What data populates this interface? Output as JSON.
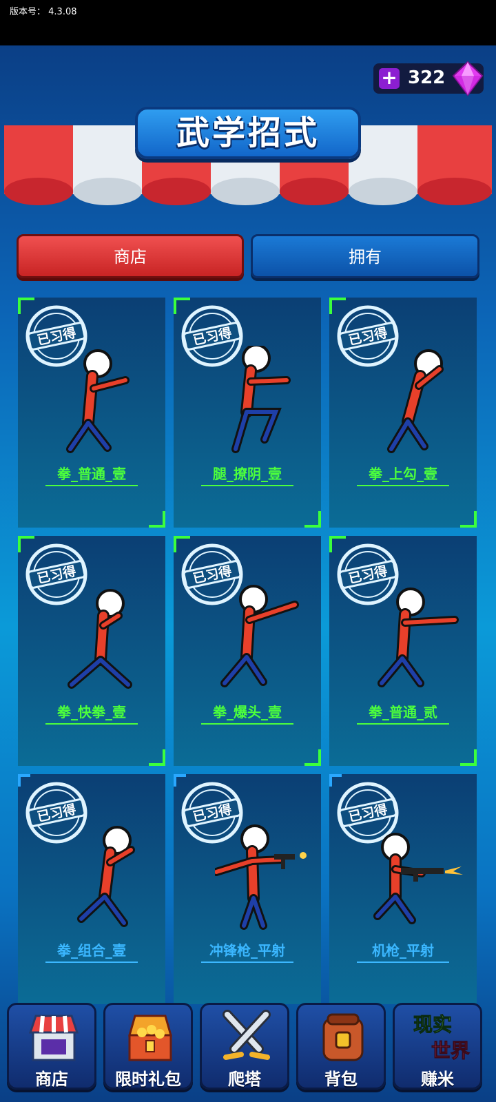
{
  "status": {
    "version_label": "版本号：",
    "version": "4.3.08"
  },
  "currency": {
    "gems": "322"
  },
  "title": "武学招式",
  "tabs": [
    {
      "label": "商店",
      "active": true
    },
    {
      "label": "拥有",
      "active": false
    }
  ],
  "stamp_text": "已习得",
  "moves": [
    {
      "name": "拳_普通_壹",
      "style": "green",
      "pose": "punch"
    },
    {
      "name": "腿_撩阴_壹",
      "style": "green",
      "pose": "kick"
    },
    {
      "name": "拳_上勾_壹",
      "style": "green",
      "pose": "uppercut"
    },
    {
      "name": "拳_快拳_壹",
      "style": "green",
      "pose": "quick"
    },
    {
      "name": "拳_爆头_壹",
      "style": "green",
      "pose": "headshot"
    },
    {
      "name": "拳_普通_贰",
      "style": "green",
      "pose": "punch2"
    },
    {
      "name": "拳_组合_壹",
      "style": "blue",
      "pose": "combo"
    },
    {
      "name": "冲锋枪_平射",
      "style": "blue",
      "pose": "smg"
    },
    {
      "name": "机枪_平射",
      "style": "blue",
      "pose": "mg"
    }
  ],
  "nav": [
    {
      "label": "商店",
      "icon": "shop-icon"
    },
    {
      "label": "限时礼包",
      "icon": "treasure-chest-icon"
    },
    {
      "label": "爬塔",
      "icon": "crossed-swords-icon"
    },
    {
      "label": "背包",
      "icon": "backpack-icon"
    },
    {
      "label": "赚米",
      "icon": "real-world-icon",
      "icon_text_top": "现实",
      "icon_text_bottom": "世界"
    }
  ],
  "colors": {
    "label_green": "#4cff3c",
    "label_blue": "#3bb7ff",
    "tab_red": "#e03434",
    "tab_blue": "#1266c9"
  }
}
